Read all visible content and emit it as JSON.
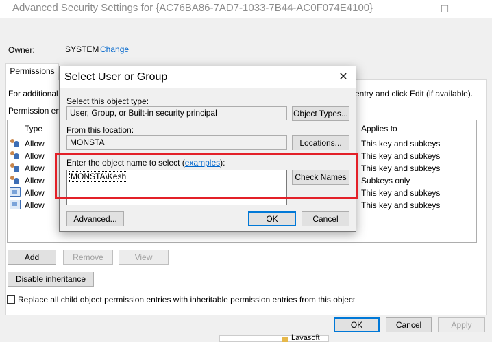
{
  "window": {
    "title": "Advanced Security Settings for {AC76BA86-7AD7-1033-7B44-AC0F074E4100}",
    "minimize_glyph": "—",
    "maximize_glyph": "☐"
  },
  "owner": {
    "label": "Owner:",
    "value": "SYSTEM",
    "change_link": "Change"
  },
  "tabs": [
    {
      "label": "Permissions"
    }
  ],
  "info": {
    "left_text": "For additional",
    "right_text": "entry and click Edit (if available)."
  },
  "permissions": {
    "label": "Permission ent",
    "columns": {
      "type": "Type",
      "applies": "Applies to"
    },
    "rows": [
      {
        "icon": "users-icon",
        "type": "Allow",
        "applies": "This key and subkeys"
      },
      {
        "icon": "users-icon",
        "type": "Allow",
        "applies": "This key and subkeys"
      },
      {
        "icon": "users-icon",
        "type": "Allow",
        "applies": "This key and subkeys"
      },
      {
        "icon": "users-icon",
        "type": "Allow",
        "applies": "Subkeys only"
      },
      {
        "icon": "computer-icon",
        "type": "Allow",
        "applies": "This key and subkeys"
      },
      {
        "icon": "computer-icon",
        "type": "Allow",
        "applies": "This key and subkeys"
      }
    ]
  },
  "buttons": {
    "add": "Add",
    "remove": "Remove",
    "view": "View",
    "disable_inheritance": "Disable inheritance",
    "ok": "OK",
    "cancel": "Cancel",
    "apply": "Apply"
  },
  "replace_checkbox": {
    "label": "Replace all child object permission entries with inheritable permission entries from this object",
    "checked": false
  },
  "taskbar_item": "Lavasoft",
  "dialog": {
    "title": "Select User or Group",
    "close_glyph": "✕",
    "object_type_label": "Select this object type:",
    "object_type_value": "User, Group, or Built-in security principal",
    "object_types_button": "Object Types...",
    "location_label": "From this location:",
    "location_value": "MONSTA",
    "locations_button": "Locations...",
    "name_label": "Enter the object name to select (",
    "examples_link": "examples",
    "name_label_end": "):",
    "name_value": "MONSTA\\Kesh",
    "check_names_button": "Check Names",
    "advanced_button": "Advanced...",
    "ok_button": "OK",
    "cancel_button": "Cancel"
  },
  "colors": {
    "highlight": "#e32028",
    "link": "#0066cc",
    "accent": "#0078d7"
  }
}
